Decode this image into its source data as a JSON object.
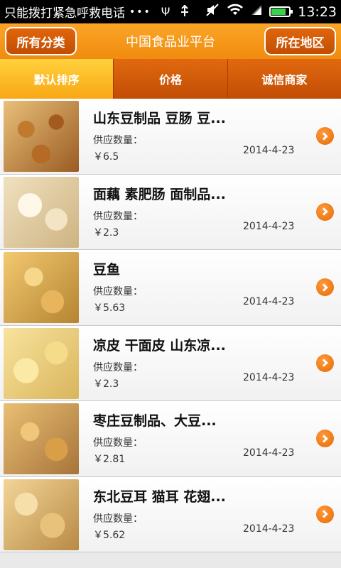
{
  "status_bar": {
    "emergency_text": "只能拨打紧急呼救电话",
    "overflow": "•••",
    "usb_symbol": "Ψ",
    "time": "13:23",
    "battery_level": 0.75
  },
  "header": {
    "title": "中国食品业平台",
    "left_button": "所有分类",
    "right_button": "所在地区"
  },
  "tabs": [
    {
      "label": "默认排序",
      "active": true
    },
    {
      "label": "价格",
      "active": false
    },
    {
      "label": "诚信商家",
      "active": false
    }
  ],
  "items": [
    {
      "name": "山东豆制品 豆肠 豆...",
      "qty_label": "供应数量：",
      "price": "￥6.5",
      "date": "2014-4-23"
    },
    {
      "name": "面藕 素肥肠 面制品...",
      "qty_label": "供应数量：",
      "price": "￥2.3",
      "date": "2014-4-23"
    },
    {
      "name": "豆鱼",
      "qty_label": "供应数量：",
      "price": "￥5.63",
      "date": "2014-4-23"
    },
    {
      "name": "凉皮 干面皮 山东凉...",
      "qty_label": "供应数量：",
      "price": "￥2.3",
      "date": "2014-4-23"
    },
    {
      "name": "枣庄豆制品、大豆...",
      "qty_label": "供应数量：",
      "price": "￥2.81",
      "date": "2014-4-23"
    },
    {
      "name": "东北豆耳 猫耳 花翅...",
      "qty_label": "供应数量：",
      "price": "￥5.62",
      "date": "2014-4-23"
    }
  ]
}
